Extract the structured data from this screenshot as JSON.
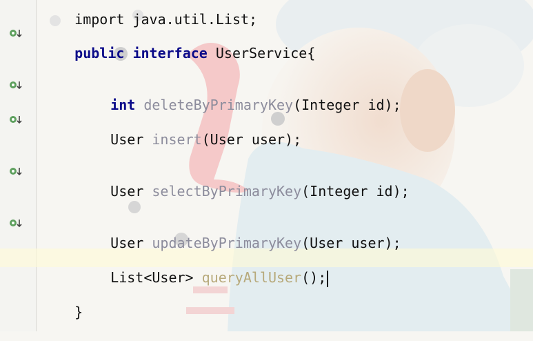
{
  "code": {
    "import_line": "import java.util.List;",
    "interface_decl": {
      "kw1": "public",
      "kw2": "interface",
      "name": "UserService{"
    },
    "methods": [
      {
        "return": "int",
        "name": "deleteByPrimaryKey",
        "params": "(Integer id);"
      },
      {
        "return": "User",
        "name": "insert",
        "params": "(User user);"
      },
      {
        "return": "User",
        "name": "selectByPrimaryKey",
        "params": "(Integer id);"
      },
      {
        "return": "User",
        "name": "updateByPrimaryKey",
        "params": "(User user);"
      },
      {
        "return": "List<User>",
        "name": "queryAllUser",
        "params": "();"
      }
    ],
    "closing_brace": "}"
  },
  "gutter": {
    "icon": "implemented-method-icon"
  },
  "colors": {
    "keyword": "#0b0b89",
    "method": "#8c8c9c",
    "caret_line": "#fffad6"
  }
}
